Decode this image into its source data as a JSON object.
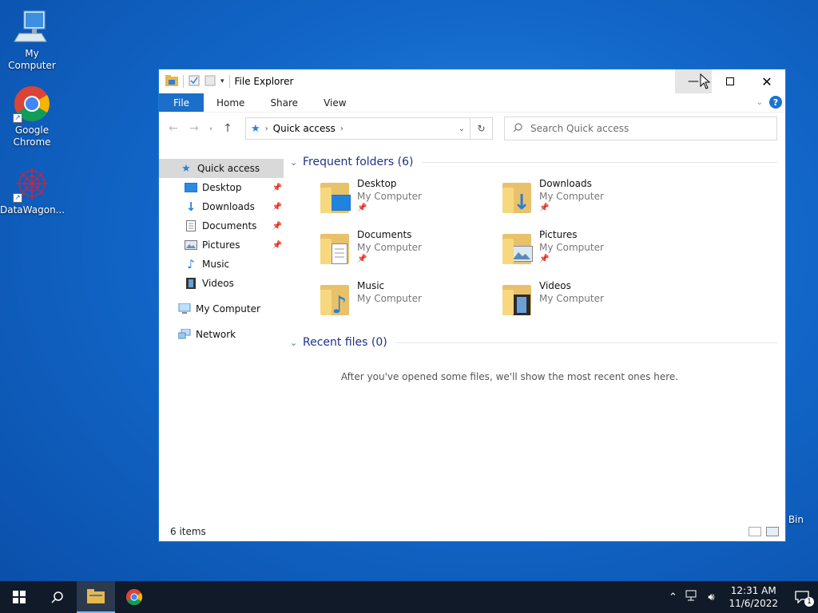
{
  "desktop": {
    "icons": [
      {
        "label": "My Computer"
      },
      {
        "label": "Google Chrome"
      },
      {
        "label": "DataWagon..."
      },
      {
        "label": "Bin"
      }
    ]
  },
  "window": {
    "title": "File Explorer",
    "tabs": {
      "file": "File",
      "home": "Home",
      "share": "Share",
      "view": "View"
    },
    "address": {
      "location": "Quick access"
    },
    "search": {
      "placeholder": "Search Quick access"
    },
    "nav": {
      "quick_access": "Quick access",
      "desktop": "Desktop",
      "downloads": "Downloads",
      "documents": "Documents",
      "pictures": "Pictures",
      "music": "Music",
      "videos": "Videos",
      "my_computer": "My Computer",
      "network": "Network"
    },
    "frequent": {
      "heading": "Frequent folders (6)",
      "folders": [
        {
          "name": "Desktop",
          "location": "My Computer"
        },
        {
          "name": "Downloads",
          "location": "My Computer"
        },
        {
          "name": "Documents",
          "location": "My Computer"
        },
        {
          "name": "Pictures",
          "location": "My Computer"
        },
        {
          "name": "Music",
          "location": "My Computer"
        },
        {
          "name": "Videos",
          "location": "My Computer"
        }
      ]
    },
    "recent": {
      "heading": "Recent files (0)",
      "empty_message": "After you've opened some files, we'll show the most recent ones here."
    },
    "status": {
      "items": "6 items"
    }
  },
  "taskbar": {
    "clock": {
      "time": "12:31 AM",
      "date": "11/6/2022"
    },
    "notification_count": "1"
  },
  "colors": {
    "accent": "#1b6fc9",
    "taskbar": "#101a28",
    "heading": "#1e3287"
  }
}
